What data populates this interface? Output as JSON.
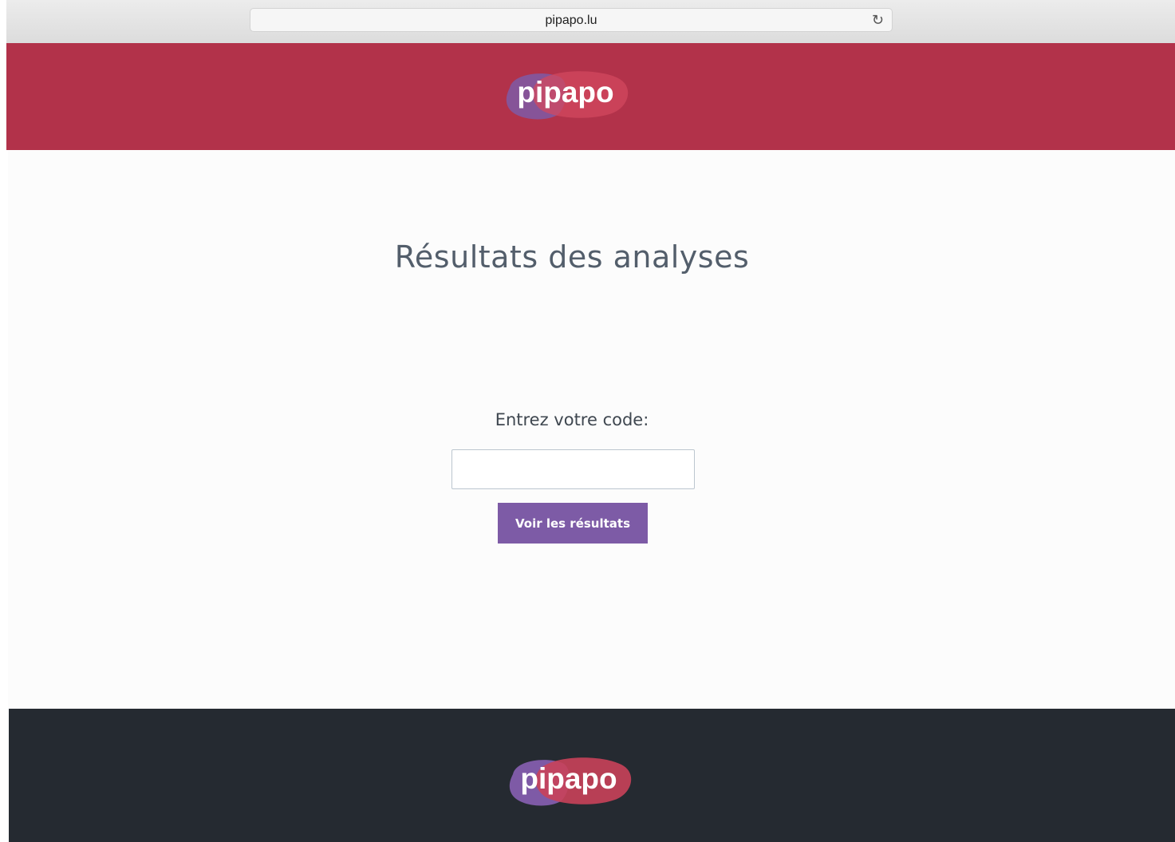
{
  "browser": {
    "url": "pipapo.lu",
    "reload_icon": "reload-icon"
  },
  "header": {
    "logo_text": "pipapo"
  },
  "main": {
    "title": "Résultats des analyses",
    "code_label": "Entrez votre code:",
    "code_input": {
      "value": "",
      "placeholder": ""
    },
    "submit_label": "Voir les résultats"
  },
  "footer": {
    "logo_text": "pipapo"
  },
  "colors": {
    "header_bg": "#b2324a",
    "button_bg": "#7d5ba6",
    "footer_bg": "#252a31",
    "title_text": "#535e6b"
  }
}
